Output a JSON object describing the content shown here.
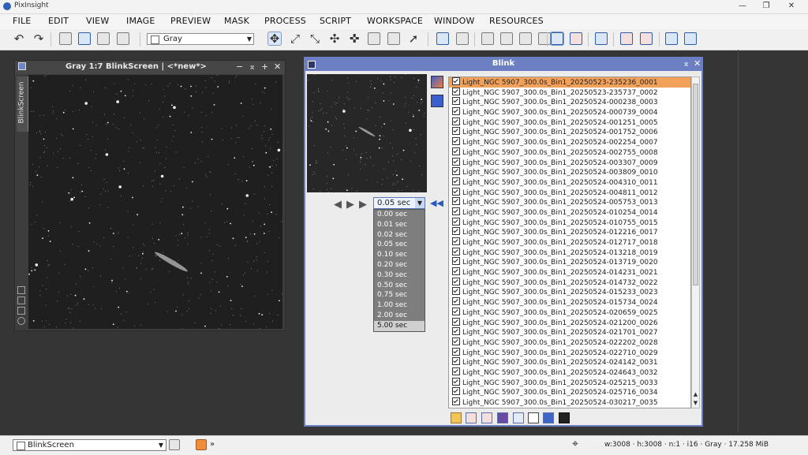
{
  "app": {
    "title": "PixInsight"
  },
  "window_controls": {
    "minimize": "—",
    "maximize": "❐",
    "close": "✕"
  },
  "menu": [
    "FILE",
    "EDIT",
    "VIEW",
    "IMAGE",
    "PREVIEW",
    "MASK",
    "PROCESS",
    "SCRIPT",
    "WORKSPACE",
    "WINDOW",
    "RESOURCES"
  ],
  "toolbar": {
    "mask_combo_value": "Gray"
  },
  "image_window": {
    "title": "Gray 1:7 BlinkScreen | <*new*>",
    "side_tab": "BlinkScreen",
    "controls": {
      "minimize": "−",
      "shade": "⌅",
      "maximize": "+",
      "close": "✕"
    }
  },
  "blink": {
    "title": "Blink",
    "header_controls": {
      "shade": "⌅",
      "close": "✕"
    },
    "nav": {
      "prev": "◀",
      "play": "▶",
      "next": "▶",
      "rewind": "◀◀"
    },
    "interval": {
      "value": "0.05 sec",
      "options": [
        "0.00 sec",
        "0.01 sec",
        "0.02 sec",
        "0.05 sec",
        "0.10 sec",
        "0.20 sec",
        "0.30 sec",
        "0.50 sec",
        "0.75 sec",
        "1.00 sec",
        "2.00 sec",
        "5.00 sec"
      ],
      "highlighted": "5.00 sec"
    },
    "files": [
      "Light_NGC 5907_300.0s_Bin1_20250523-235236_0001",
      "Light_NGC 5907_300.0s_Bin1_20250523-235737_0002",
      "Light_NGC 5907_300.0s_Bin1_20250524-000238_0003",
      "Light_NGC 5907_300.0s_Bin1_20250524-000739_0004",
      "Light_NGC 5907_300.0s_Bin1_20250524-001251_0005",
      "Light_NGC 5907_300.0s_Bin1_20250524-001752_0006",
      "Light_NGC 5907_300.0s_Bin1_20250524-002254_0007",
      "Light_NGC 5907_300.0s_Bin1_20250524-002755_0008",
      "Light_NGC 5907_300.0s_Bin1_20250524-003307_0009",
      "Light_NGC 5907_300.0s_Bin1_20250524-003809_0010",
      "Light_NGC 5907_300.0s_Bin1_20250524-004310_0011",
      "Light_NGC 5907_300.0s_Bin1_20250524-004811_0012",
      "Light_NGC 5907_300.0s_Bin1_20250524-005753_0013",
      "Light_NGC 5907_300.0s_Bin1_20250524-010254_0014",
      "Light_NGC 5907_300.0s_Bin1_20250524-010755_0015",
      "Light_NGC 5907_300.0s_Bin1_20250524-012216_0017",
      "Light_NGC 5907_300.0s_Bin1_20250524-012717_0018",
      "Light_NGC 5907_300.0s_Bin1_20250524-013218_0019",
      "Light_NGC 5907_300.0s_Bin1_20250524-013719_0020",
      "Light_NGC 5907_300.0s_Bin1_20250524-014231_0021",
      "Light_NGC 5907_300.0s_Bin1_20250524-014732_0022",
      "Light_NGC 5907_300.0s_Bin1_20250524-015233_0023",
      "Light_NGC 5907_300.0s_Bin1_20250524-015734_0024",
      "Light_NGC 5907_300.0s_Bin1_20250524-020659_0025",
      "Light_NGC 5907_300.0s_Bin1_20250524-021200_0026",
      "Light_NGC 5907_300.0s_Bin1_20250524-021701_0027",
      "Light_NGC 5907_300.0s_Bin1_20250524-022202_0028",
      "Light_NGC 5907_300.0s_Bin1_20250524-022710_0029",
      "Light_NGC 5907_300.0s_Bin1_20250524-024142_0031",
      "Light_NGC 5907_300.0s_Bin1_20250524-024643_0032",
      "Light_NGC 5907_300.0s_Bin1_20250524-025215_0033",
      "Light_NGC 5907_300.0s_Bin1_20250524-025716_0034",
      "Light_NGC 5907_300.0s_Bin1_20250524-030217_0035"
    ],
    "selected_index": 0,
    "scroll": {
      "up": "▲",
      "down": "▼"
    },
    "bottom_tool_icons": [
      "folder-open-icon",
      "close-selected-icon",
      "close-all-icon",
      "save-icon",
      "move-icon",
      "crop-icon",
      "statistics-icon",
      "video-icon"
    ]
  },
  "statusbar": {
    "view_combo_value": "BlinkScreen",
    "more": "»",
    "info": "w:3008 · h:3008 · n:1 · i16 · Gray · 17.258 MiB"
  },
  "colors": {
    "blink_header": "#6c7fc2",
    "selected_row": "#f2a15a",
    "desktop": "#353535"
  }
}
